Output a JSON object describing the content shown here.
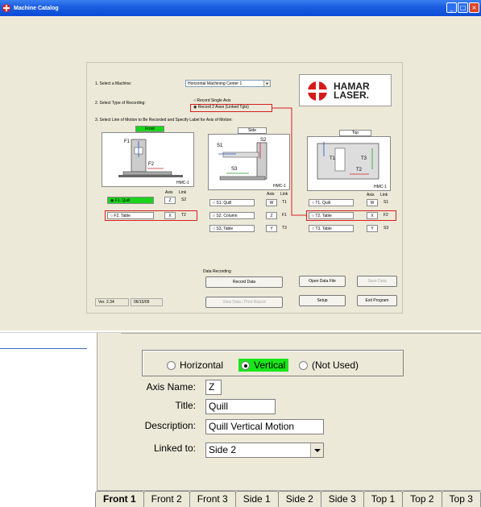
{
  "window": {
    "title": "Machine Catalog",
    "min": "_",
    "max": "□",
    "close": "×"
  },
  "panel": {
    "step1": "1. Select a Machine:",
    "machine": "Horizontal Machining Center 1",
    "step2": "2. Select Type of Recording:",
    "rec_single": "Record Single Axis",
    "rec_two": "Record 2 Axes (Linked Tgts)",
    "step3": "3. Select Line of Motion to Be Recorded and Specify Label for Axis of Motion:",
    "logo": "HAMAR LASER",
    "views": [
      {
        "label": "Front",
        "model": "HMC-1",
        "rows": [
          {
            "label": "F1. Quill",
            "axis": "Z",
            "link": "S2",
            "selected": true
          },
          {
            "label": "F2. Table",
            "axis": "X",
            "link": "T2",
            "selected": false
          }
        ]
      },
      {
        "label": "Side",
        "model": "HMC-1",
        "rows": [
          {
            "label": "S1. Quill",
            "axis": "W",
            "link": "T1",
            "selected": false
          },
          {
            "label": "S2. Column",
            "axis": "Z",
            "link": "F1",
            "selected": false
          },
          {
            "label": "S3. Table",
            "axis": "Y",
            "link": "T3",
            "selected": false
          }
        ]
      },
      {
        "label": "Top",
        "model": "HMC-1",
        "rows": [
          {
            "label": "T1. Quill",
            "axis": "W",
            "link": "S1",
            "selected": false
          },
          {
            "label": "T2. Table",
            "axis": "X",
            "link": "F2",
            "selected": false
          },
          {
            "label": "T3. Table",
            "axis": "Y",
            "link": "S3",
            "selected": false
          }
        ]
      }
    ],
    "col_axis": "Axis",
    "col_link": "Link",
    "front_labels": {
      "f1": "F1",
      "f2": "F2"
    },
    "side_labels": {
      "s1": "S1",
      "s2": "S2",
      "s3": "S3"
    },
    "top_labels": {
      "t1": "T1",
      "t2": "T2",
      "t3": "T3"
    },
    "data_recording": "Data Recording",
    "record_data": "Record Data",
    "view_data": "View Data / Print Report",
    "open_file": "Open Data File",
    "save_data": "Save Data",
    "setup": "Setup",
    "exit": "Exit Program",
    "version": "Ver. 2.34",
    "date": "06/15/09"
  },
  "dialog": {
    "orientation": [
      {
        "label": "Horizontal",
        "selected": false
      },
      {
        "label": "Vertical",
        "selected": true
      },
      {
        "label": "(Not Used)",
        "selected": false
      }
    ],
    "axis_name_label": "Axis Name:",
    "axis_name": "Z",
    "title_label": "Title:",
    "title": "Quill",
    "description_label": "Description:",
    "description": "Quill Vertical Motion",
    "linked_label": "Linked to:",
    "linked": "Side 2"
  },
  "tabs": [
    "Front 1",
    "Front 2",
    "Front 3",
    "Side 1",
    "Side 2",
    "Side 3",
    "Top 1",
    "Top 2",
    "Top 3"
  ],
  "colors": {
    "selected_green": "#19e619",
    "title_blue": "#0a4bd6",
    "hamar_red": "#d71a1a",
    "link_red": "#d81e1e"
  }
}
